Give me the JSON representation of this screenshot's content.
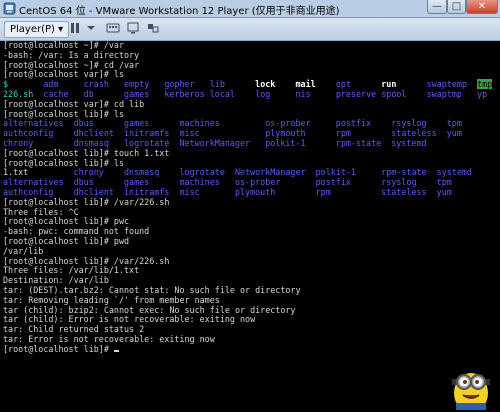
{
  "window": {
    "title": "CentOS 64 位 - VMware Workstation 12 Player (仅用于非商业用途)",
    "player_menu": "Player(P) ▾",
    "buttons": {
      "minimize": "—",
      "maximize": "□",
      "close": "✕"
    }
  },
  "terminal": {
    "lines": [
      [
        {
          "t": "[root@localhost ~]# /var"
        }
      ],
      [
        {
          "t": "-bash: /var: Is a directory"
        }
      ],
      [
        {
          "t": "[root@localhost ~]# cd /var"
        }
      ],
      [
        {
          "t": "[root@localhost var]# ls"
        }
      ],
      [
        {
          "t": "$       ",
          "c": "c"
        },
        {
          "t": "adm     ",
          "c": "b"
        },
        {
          "t": "crash   ",
          "c": "b"
        },
        {
          "t": "empty   ",
          "c": "b"
        },
        {
          "t": "gopher   ",
          "c": "b"
        },
        {
          "t": "lib      ",
          "c": "b"
        },
        {
          "t": "lock    ",
          "c": "w"
        },
        {
          "t": "mail    ",
          "c": "w"
        },
        {
          "t": "opt      ",
          "c": "b"
        },
        {
          "t": "run      ",
          "c": "w"
        },
        {
          "t": "swaptemp  ",
          "c": "b"
        },
        {
          "t": "tmp",
          "c": "hl"
        }
      ],
      [
        {
          "t": "226.sh  ",
          "c": "c"
        },
        {
          "t": "cache   ",
          "c": "b"
        },
        {
          "t": "db      ",
          "c": "b"
        },
        {
          "t": "games   ",
          "c": "b"
        },
        {
          "t": "kerberos ",
          "c": "b"
        },
        {
          "t": "local    ",
          "c": "b"
        },
        {
          "t": "log     ",
          "c": "b"
        },
        {
          "t": "nis     ",
          "c": "b"
        },
        {
          "t": "preserve ",
          "c": "b"
        },
        {
          "t": "spool    ",
          "c": "b"
        },
        {
          "t": "swaptmp   ",
          "c": "b"
        },
        {
          "t": "yp",
          "c": "b"
        }
      ],
      [
        {
          "t": "[root@localhost var]# cd lib"
        }
      ],
      [
        {
          "t": "[root@localhost lib]# ls"
        }
      ],
      [
        {
          "t": "alternatives  ",
          "c": "b"
        },
        {
          "t": "dbus      ",
          "c": "b"
        },
        {
          "t": "games      ",
          "c": "b"
        },
        {
          "t": "machines         ",
          "c": "b"
        },
        {
          "t": "os-prober     ",
          "c": "b"
        },
        {
          "t": "postfix    ",
          "c": "b"
        },
        {
          "t": "rsyslog    ",
          "c": "b"
        },
        {
          "t": "tpm",
          "c": "b"
        }
      ],
      [
        {
          "t": "authconfig    ",
          "c": "b"
        },
        {
          "t": "dhclient  ",
          "c": "b"
        },
        {
          "t": "initramfs  ",
          "c": "b"
        },
        {
          "t": "misc             ",
          "c": "b"
        },
        {
          "t": "plymouth      ",
          "c": "b"
        },
        {
          "t": "rpm        ",
          "c": "b"
        },
        {
          "t": "stateless  ",
          "c": "b"
        },
        {
          "t": "yum",
          "c": "b"
        }
      ],
      [
        {
          "t": "chrony        ",
          "c": "b"
        },
        {
          "t": "dnsmasq   ",
          "c": "b"
        },
        {
          "t": "logrotate  ",
          "c": "b"
        },
        {
          "t": "NetworkManager   ",
          "c": "b"
        },
        {
          "t": "polkit-1      ",
          "c": "b"
        },
        {
          "t": "rpm-state  ",
          "c": "b"
        },
        {
          "t": "systemd",
          "c": "b"
        }
      ],
      [
        {
          "t": "[root@localhost lib]# touch 1.txt"
        }
      ],
      [
        {
          "t": "[root@localhost lib]# ls"
        }
      ],
      [
        {
          "t": "1.txt         "
        },
        {
          "t": "chrony    ",
          "c": "b"
        },
        {
          "t": "dnsmasq    ",
          "c": "b"
        },
        {
          "t": "logrotate  ",
          "c": "b"
        },
        {
          "t": "NetworkManager  ",
          "c": "b"
        },
        {
          "t": "polkit-1     ",
          "c": "b"
        },
        {
          "t": "rpm-state  ",
          "c": "b"
        },
        {
          "t": "systemd",
          "c": "b"
        }
      ],
      [
        {
          "t": "alternatives  ",
          "c": "b"
        },
        {
          "t": "dbus      ",
          "c": "b"
        },
        {
          "t": "games      ",
          "c": "b"
        },
        {
          "t": "machines   ",
          "c": "b"
        },
        {
          "t": "os-prober       ",
          "c": "b"
        },
        {
          "t": "postfix      ",
          "c": "b"
        },
        {
          "t": "rsyslog    ",
          "c": "b"
        },
        {
          "t": "tpm",
          "c": "b"
        }
      ],
      [
        {
          "t": "authconfig    ",
          "c": "b"
        },
        {
          "t": "dhclient  ",
          "c": "b"
        },
        {
          "t": "initramfs  ",
          "c": "b"
        },
        {
          "t": "misc       ",
          "c": "b"
        },
        {
          "t": "plymouth        ",
          "c": "b"
        },
        {
          "t": "rpm          ",
          "c": "b"
        },
        {
          "t": "stateless  ",
          "c": "b"
        },
        {
          "t": "yum",
          "c": "b"
        }
      ],
      [
        {
          "t": "[root@localhost lib]# /var/226.sh"
        }
      ],
      [
        {
          "t": "Three files: ^C"
        }
      ],
      [
        {
          "t": "[root@localhost lib]# pwc"
        }
      ],
      [
        {
          "t": "-bash: pwc: command not found"
        }
      ],
      [
        {
          "t": "[root@localhost lib]# pwd"
        }
      ],
      [
        {
          "t": "/var/lib"
        }
      ],
      [
        {
          "t": "[root@localhost lib]# /var/226.sh"
        }
      ],
      [
        {
          "t": "Three files: /var/lib/1.txt"
        }
      ],
      [
        {
          "t": "Destination: /var/lib"
        }
      ],
      [
        {
          "t": "tar: (DEST).tar.bz2: Cannot stat: No such file or directory"
        }
      ],
      [
        {
          "t": "tar: Removing leading `/' from member names"
        }
      ],
      [
        {
          "t": "tar (child): bzip2: Cannot exec: No such file or directory"
        }
      ],
      [
        {
          "t": "tar (child): Error is not recoverable: exiting now"
        }
      ],
      [
        {
          "t": "tar: Child returned status 2"
        }
      ],
      [
        {
          "t": "tar: Error is not recoverable: exiting now"
        }
      ],
      [
        {
          "t": "[root@localhost lib]# "
        }
      ]
    ]
  }
}
